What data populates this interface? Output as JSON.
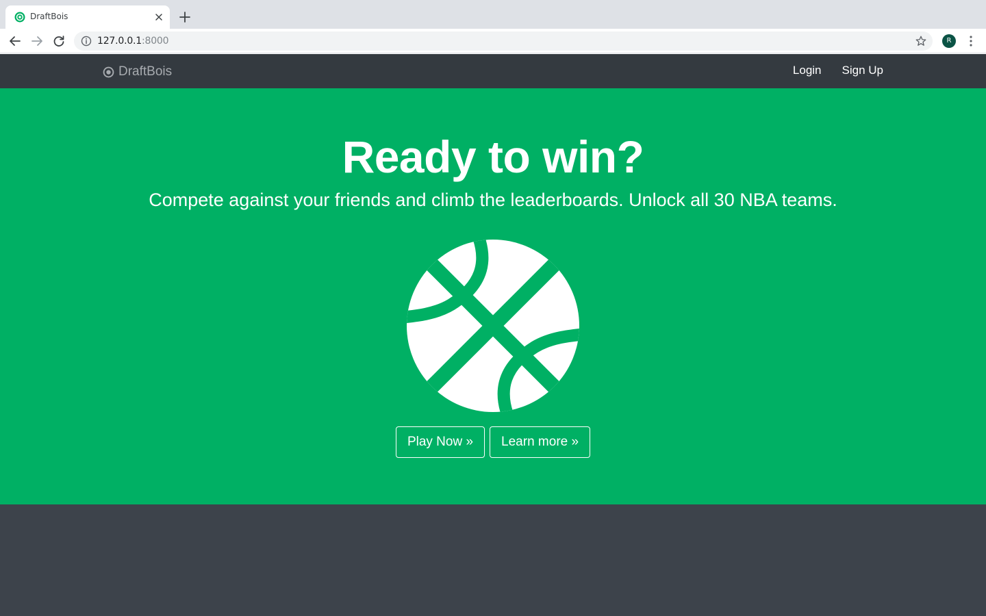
{
  "browser": {
    "tab_title": "DraftBois",
    "url_host": "127.0.0.1",
    "url_port": ":8000",
    "profile_initial": "R"
  },
  "navbar": {
    "brand": "DraftBois",
    "links": [
      {
        "label": "Login"
      },
      {
        "label": "Sign Up"
      }
    ]
  },
  "hero": {
    "title": "Ready to win?",
    "subtitle": "Compete against your friends and climb the leaderboards. Unlock all 30 NBA teams.",
    "buttons": [
      {
        "label": "Play Now »"
      },
      {
        "label": "Learn more »"
      }
    ]
  },
  "colors": {
    "hero_bg": "#00b064",
    "navbar_bg": "#343a40",
    "footer_bg": "#3d434b"
  },
  "icons": {
    "brand": "dot-circle-icon",
    "hero": "basketball-icon"
  }
}
